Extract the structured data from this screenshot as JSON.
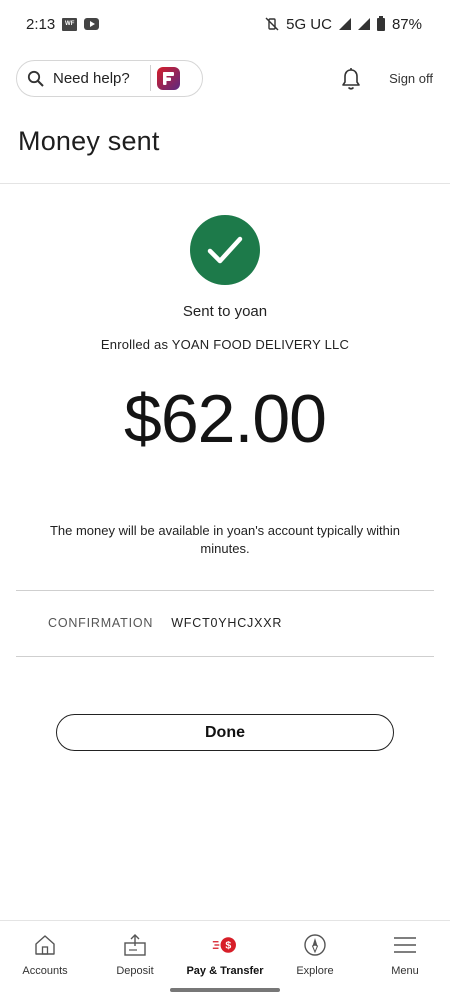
{
  "status_bar": {
    "time": "2:13",
    "app_badge": "WF",
    "network": "5G UC",
    "battery": "87%"
  },
  "header": {
    "search_placeholder": "Need help?",
    "sign_off": "Sign off"
  },
  "page": {
    "title": "Money sent",
    "sent_to": "Sent to yoan",
    "enrolled_as": "Enrolled as YOAN FOOD DELIVERY LLC",
    "amount": "$62.00",
    "availability_note": "The money will be available in yoan's account typically within minutes.",
    "confirmation_label": "CONFIRMATION",
    "confirmation_value": "WFCT0YHCJXXR",
    "done_label": "Done"
  },
  "bottom_nav": {
    "items": [
      {
        "label": "Accounts",
        "icon": "home-icon"
      },
      {
        "label": "Deposit",
        "icon": "deposit-icon"
      },
      {
        "label": "Pay & Transfer",
        "icon": "pay-transfer-icon",
        "active": true
      },
      {
        "label": "Explore",
        "icon": "compass-icon"
      },
      {
        "label": "Menu",
        "icon": "menu-icon"
      }
    ]
  },
  "colors": {
    "success_green": "#1d7a4a",
    "brand_red": "#d71e28",
    "brand_purple": "#5a2a82"
  }
}
